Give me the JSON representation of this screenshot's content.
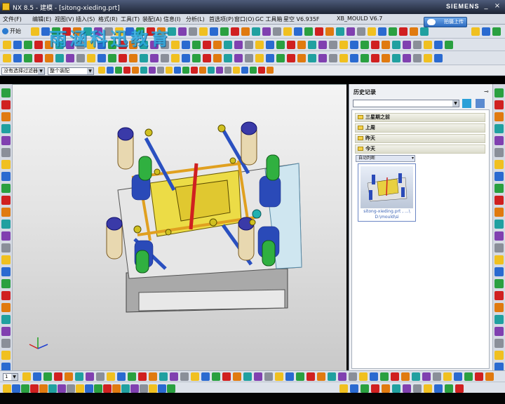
{
  "window": {
    "title": "NX 8.5 - 建模 - [sitong-xieding.prt]",
    "brand": "SIEMENS",
    "controls": [
      "_",
      "□",
      "×"
    ]
  },
  "menu": {
    "items": [
      "文件(F)",
      "编辑(E)",
      "视图(V)",
      "插入(S)",
      "格式(R)",
      "工具(T)",
      "装配(A)",
      "信息(I)",
      "分析(L)",
      "首选项(P)",
      "窗口(O)",
      "GC 工具箱",
      "星空 V6.935F",
      "XB_MOULD V6.7"
    ]
  },
  "toolbar": {
    "start_label": "开始",
    "cloud_label": "拍摄上传",
    "watermark": "雨涵科迅教育",
    "filter_label": "没有选择过滤器",
    "assembly_label": "整个装配",
    "colors": {
      "yellow": "#f0c020",
      "blue": "#2a6ad0",
      "green": "#2aa040",
      "red": "#d02020",
      "orange": "#e07a10",
      "teal": "#20a0a0",
      "purple": "#8040b0",
      "gray": "#8a8f99"
    }
  },
  "history_panel": {
    "title": "历史记录",
    "groups": [
      "三星期之前",
      "上周",
      "昨天",
      "今天"
    ],
    "subgroup_label": "自动判断",
    "thumbnail_caption_line1": "sitong-xieding.prt , ...\\",
    "thumbnail_caption_line2": "D:\\mould\\si"
  },
  "bottom": {
    "select_value": "1"
  }
}
